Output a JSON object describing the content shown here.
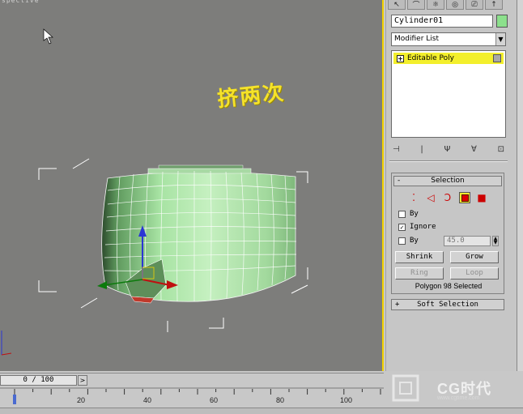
{
  "viewport": {
    "label": "spective",
    "annotation": "挤两次"
  },
  "panel": {
    "tabs": [
      "↖",
      "⌒",
      "⚛",
      "◎",
      "⎚",
      "↑"
    ],
    "object_name": "Cylinder01",
    "object_color": "#8ce08c",
    "modifier_list": "Modifier List",
    "stack_item": "Editable Poly",
    "stack_tools": [
      "⊣",
      "|",
      "Ψ",
      "∀",
      "⊡"
    ],
    "selection": {
      "title": "Selection",
      "icons": [
        "vertex-icon",
        "edge-icon",
        "border-icon",
        "polygon-icon",
        "element-icon"
      ],
      "by_vertex_label": "By",
      "ignore_backfacing_label": "Ignore",
      "by_angle_label": "By",
      "angle_value": "45.0",
      "shrink": "Shrink",
      "grow": "Grow",
      "ring": "Ring",
      "loop": "Loop",
      "status": "Polygon 98 Selected"
    },
    "soft_selection_title": "Soft Selection"
  },
  "time": {
    "frame": "0 / 100",
    "next": ">",
    "current_frame": 0,
    "total_frames": 100,
    "ticks": [
      "20",
      "40",
      "60",
      "80",
      "100"
    ]
  },
  "logo": {
    "text": "CG时代",
    "url": "www.cgtime.com"
  },
  "colors": {
    "viewport_bg": "#7d7d7b",
    "active_yellow": "#f3ef2c",
    "mesh_green": "#a7e3a3",
    "annotation": "#f5e22a"
  }
}
